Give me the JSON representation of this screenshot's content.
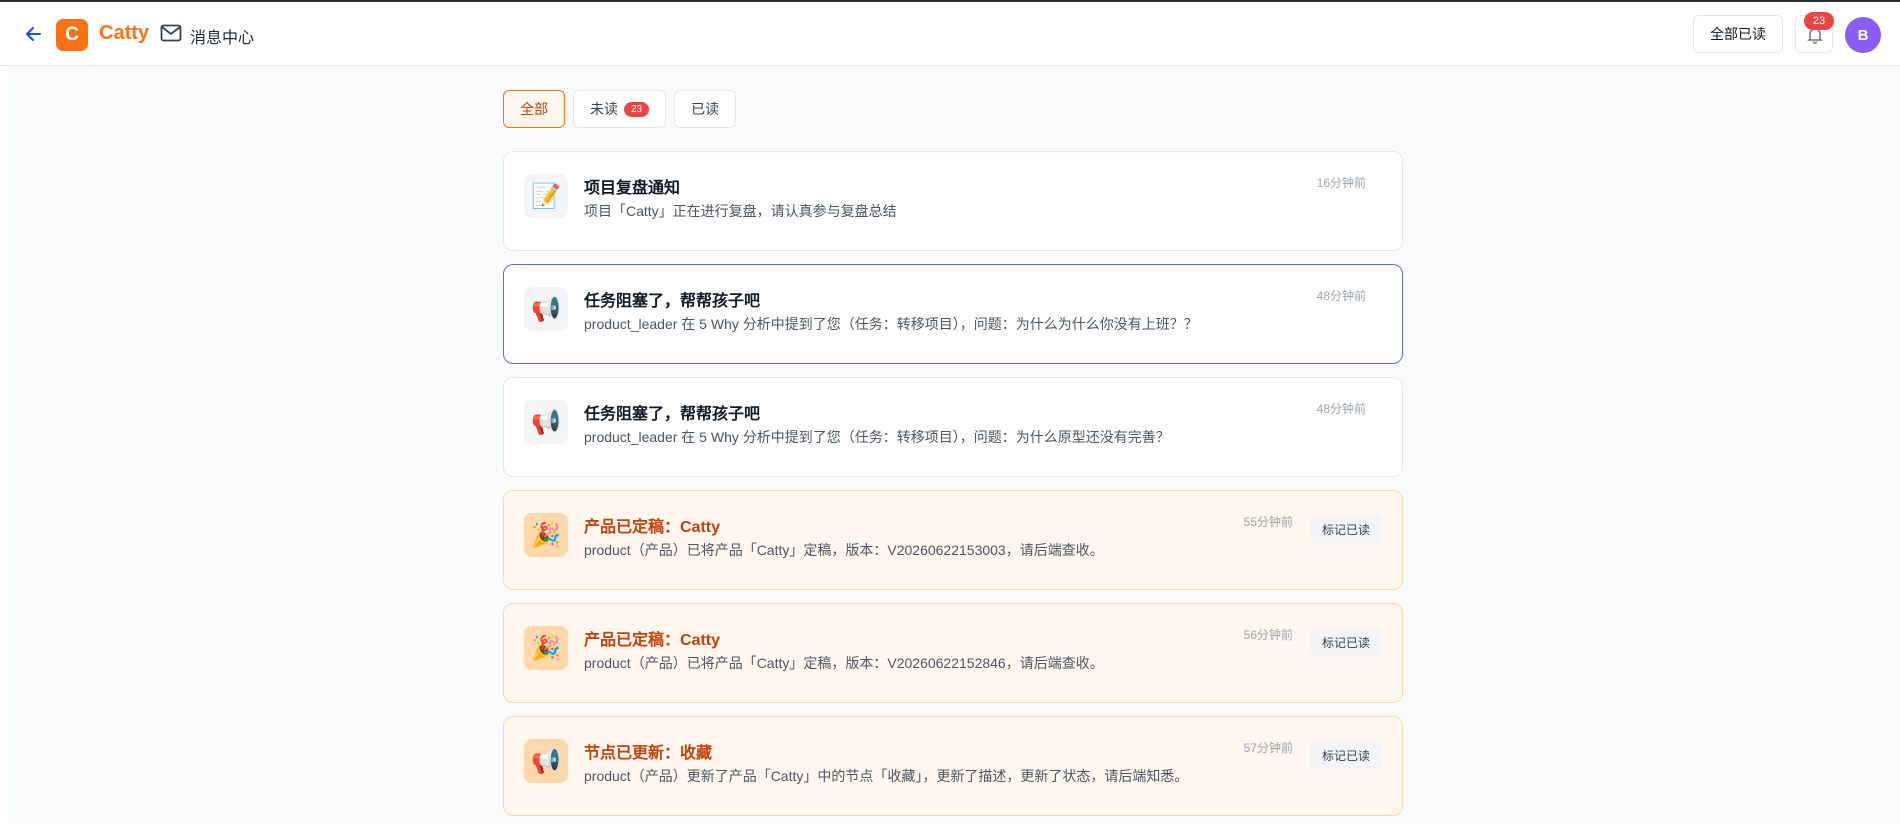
{
  "header": {
    "logo_letter": "C",
    "brand": "Catty",
    "page_title": "消息中心",
    "mark_all_label": "全部已读",
    "bell_badge": "23",
    "avatar_letter": "B",
    "icons": {
      "back": "arrow-left-icon",
      "mail": "mail-icon",
      "bell": "bell-icon"
    }
  },
  "tabs": [
    {
      "label": "全部",
      "active": true
    },
    {
      "label": "未读",
      "badge": "23"
    },
    {
      "label": "已读"
    }
  ],
  "notifications": [
    {
      "icon": "📝",
      "icon_name": "memo-icon",
      "title": "项目复盘通知",
      "body": "项目「Catty」正在进行复盘，请认真参与复盘总结",
      "time": "16分钟前",
      "unread": false
    },
    {
      "icon": "📢",
      "icon_name": "megaphone-icon",
      "title": "任务阻塞了，帮帮孩子吧",
      "body": "product_leader 在 5 Why 分析中提到了您（任务：转移项目），问题：为什么为什么你没有上班？？",
      "time": "48分钟前",
      "unread": false,
      "highlight": true
    },
    {
      "icon": "📢",
      "icon_name": "megaphone-icon",
      "title": "任务阻塞了，帮帮孩子吧",
      "body": "product_leader 在 5 Why 分析中提到了您（任务：转移项目），问题：为什么原型还没有完善？",
      "time": "48分钟前",
      "unread": false
    },
    {
      "icon": "🎉",
      "icon_name": "party-popper-icon",
      "title": "产品已定稿：Catty",
      "body": "product（产品）已将产品「Catty」定稿，版本：V20260622153003，请后端查收。",
      "time": "55分钟前",
      "unread": true,
      "mark_label": "标记已读"
    },
    {
      "icon": "🎉",
      "icon_name": "party-popper-icon",
      "title": "产品已定稿：Catty",
      "body": "product（产品）已将产品「Catty」定稿，版本：V20260622152846，请后端查收。",
      "time": "56分钟前",
      "unread": true,
      "mark_label": "标记已读"
    },
    {
      "icon": "📢",
      "icon_name": "megaphone-icon",
      "title": "节点已更新：收藏",
      "body": "product（产品）更新了产品「Catty」中的节点「收藏」，更新了描述，更新了状态，请后端知悉。",
      "time": "57分钟前",
      "unread": true,
      "mark_label": "标记已读"
    }
  ],
  "colors": {
    "accent": "#f97316",
    "unread_bg": "#fff7ed",
    "unread_title": "#c2410c",
    "badge": "#ef4444",
    "highlight_border": "#6366f1",
    "avatar": "#8b5cf6"
  }
}
